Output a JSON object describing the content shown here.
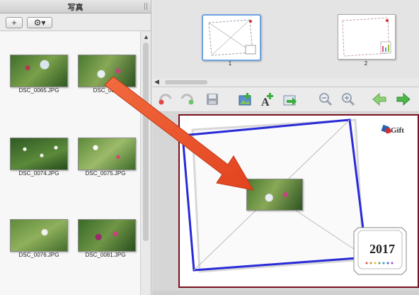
{
  "left_panel": {
    "title": "写真",
    "toolbar": {
      "add_label": "+",
      "gear_label": "⚙▾"
    },
    "photos": [
      {
        "name": "DSC_0065.JPG"
      },
      {
        "name": "DSC_006"
      },
      {
        "name": "DSC_0074.JPG"
      },
      {
        "name": "DSC_0075.JPG"
      },
      {
        "name": "DSC_0076.JPG"
      },
      {
        "name": "DSC_0081.JPG"
      }
    ]
  },
  "page_strip": {
    "pages": [
      {
        "number": "1",
        "selected": true
      },
      {
        "number": "2",
        "selected": false
      }
    ]
  },
  "editor_toolbar": {
    "icons": [
      "undo-icon",
      "redo-icon",
      "save-icon",
      "add-image-icon",
      "add-text-icon",
      "insert-icon",
      "zoom-out-icon",
      "zoom-in-icon",
      "previous-icon",
      "next-icon"
    ]
  },
  "card": {
    "logo_text": "Gift",
    "year": "2017",
    "border_color": "#7a1020",
    "frame_color": "#2a2ad8"
  },
  "colors": {
    "accent_arrow": "#ee5430",
    "selection": "#6fa3e0"
  }
}
